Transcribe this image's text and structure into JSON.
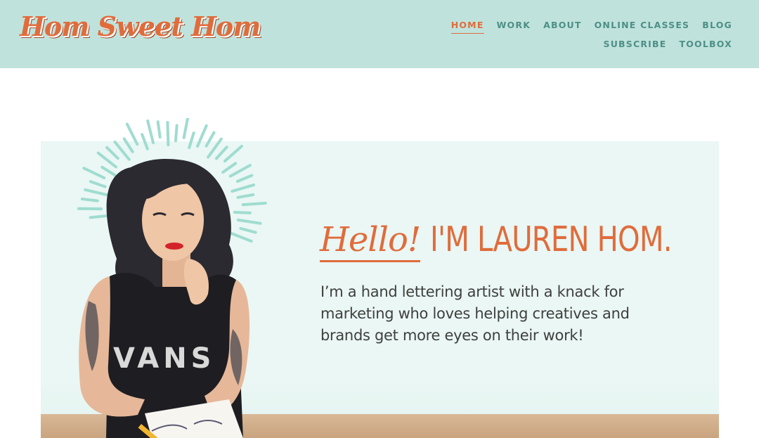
{
  "header": {
    "logo_text": "Hom Sweet Hom",
    "nav": [
      {
        "label": "HOME",
        "active": true
      },
      {
        "label": "WORK",
        "active": false
      },
      {
        "label": "ABOUT",
        "active": false
      },
      {
        "label": "ONLINE CLASSES",
        "active": false
      },
      {
        "label": "BLOG",
        "active": false
      },
      {
        "label": "SUBSCRIBE",
        "active": false
      },
      {
        "label": "TOOLBOX",
        "active": false
      }
    ]
  },
  "hero": {
    "hello": "Hello!",
    "name": "I'M LAUREN HOM.",
    "intro": "I’m a hand lettering artist with a knack for marketing who loves helping creatives and brands get more eyes on their work!",
    "shirt_text": "VANS"
  },
  "colors": {
    "header_bg": "#bfe3dc",
    "accent": "#e06c3c",
    "nav_text": "#4e8f86",
    "hero_bg": "#eaf7f4"
  }
}
